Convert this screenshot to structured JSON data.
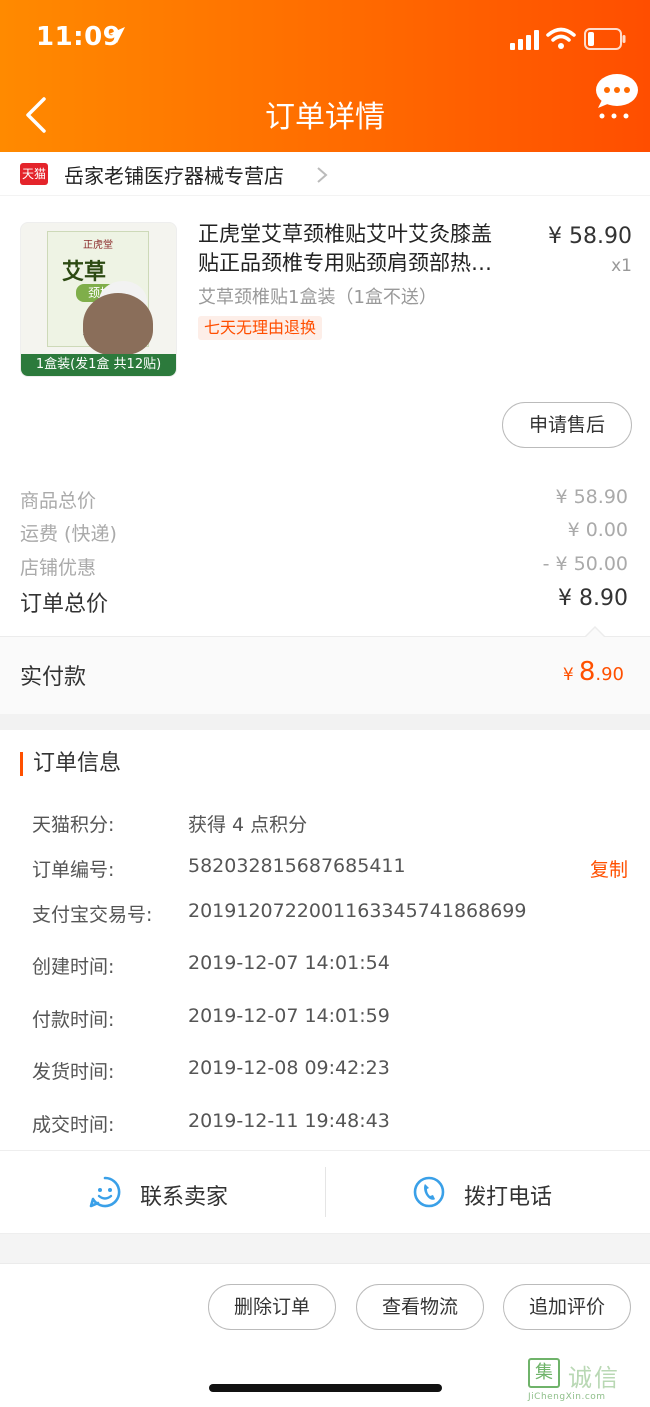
{
  "status_bar": {
    "time": "11:09"
  },
  "header": {
    "title": "订单详情"
  },
  "shop": {
    "badge": "天猫",
    "name": "岳家老铺医疗器械专营店"
  },
  "product": {
    "image": {
      "brand": "正虎堂",
      "title": "艾草",
      "subtitle": "颈椎贴",
      "count": "12",
      "bottom_label": "1盒装(发1盒 共12贴)"
    },
    "name_line1": "正虎堂艾草颈椎贴艾叶艾灸膝盖",
    "name_line2": "贴正品颈椎专用贴颈肩颈部热…",
    "price": "¥ 58.90",
    "quantity": "x1",
    "spec": "艾草颈椎贴1盒装（1盒不送）",
    "tag": "七天无理由退换",
    "after_sale_label": "申请售后"
  },
  "costs": [
    {
      "label": "商品总价",
      "value": "¥ 58.90"
    },
    {
      "label": "运费 (快递)",
      "value": "¥ 0.00"
    },
    {
      "label": "店铺优惠",
      "value": "- ¥ 50.00"
    },
    {
      "label": "订单总价",
      "value": "¥ 8.90"
    }
  ],
  "paid": {
    "label": "实付款",
    "currency": "¥",
    "integer": "8",
    "decimal": ".90"
  },
  "order_info": {
    "title": "订单信息",
    "rows": [
      {
        "label": "天猫积分:",
        "value": "获得 4 点积分"
      },
      {
        "label": "订单编号:",
        "value": "582032815687685411",
        "action": "复制"
      },
      {
        "label": "支付宝交易号:",
        "value": "2019120722001163345741868699"
      },
      {
        "label": "创建时间:",
        "value": "2019-12-07 14:01:54"
      },
      {
        "label": "付款时间:",
        "value": "2019-12-07 14:01:59"
      },
      {
        "label": "发货时间:",
        "value": "2019-12-08 09:42:23"
      },
      {
        "label": "成交时间:",
        "value": "2019-12-11 19:48:43"
      }
    ]
  },
  "contact": {
    "seller_label": "联系卖家",
    "phone_label": "拨打电话"
  },
  "actions": {
    "delete": "删除订单",
    "logistics": "查看物流",
    "review": "追加评价"
  },
  "watermark": {
    "box": "集",
    "text": "诚信",
    "sub": "JiChengXin.com"
  },
  "colors": {
    "accent": "#ff5000",
    "header_start": "#ff8a00",
    "header_end": "#ff4e00",
    "contact_icon": "#3aa0e8"
  }
}
